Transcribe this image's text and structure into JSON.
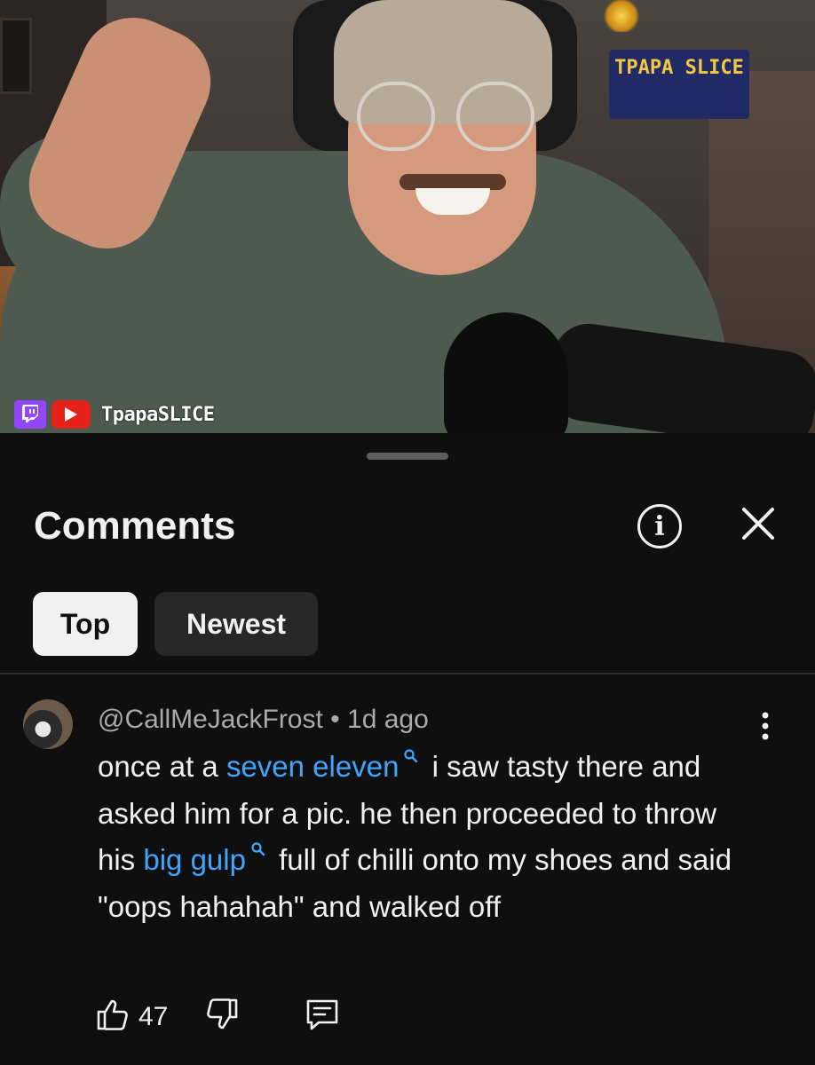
{
  "video": {
    "poster_text": "TPAPA SLICE",
    "channel_tag": "TpapaSLICE",
    "icons": [
      "twitch-icon",
      "youtube-icon"
    ]
  },
  "comments_panel": {
    "title": "Comments",
    "info_icon": "info-icon",
    "close_icon": "close-icon",
    "sort_chips": [
      {
        "label": "Top",
        "selected": true
      },
      {
        "label": "Newest",
        "selected": false
      }
    ]
  },
  "comment": {
    "author": "@CallMeJackFrost",
    "separator": "•",
    "age": "1d ago",
    "text_parts": [
      {
        "type": "text",
        "value": "once at a "
      },
      {
        "type": "link",
        "value": "seven eleven"
      },
      {
        "type": "text",
        "value": " i saw tasty there and asked him for a pic. he then proceeded to throw his "
      },
      {
        "type": "link",
        "value": "big gulp"
      },
      {
        "type": "text",
        "value": " full of chilli onto my shoes and said \"oops hahahah\" and walked off"
      }
    ],
    "likes": "47",
    "actions": [
      "like-icon",
      "dislike-icon",
      "reply-icon"
    ]
  },
  "colors": {
    "background": "#0f0f0f",
    "link": "#3ea6ff",
    "secondary_text": "#aaaaaa",
    "chip_selected_bg": "#f1f1f1",
    "chip_bg": "#272727"
  }
}
